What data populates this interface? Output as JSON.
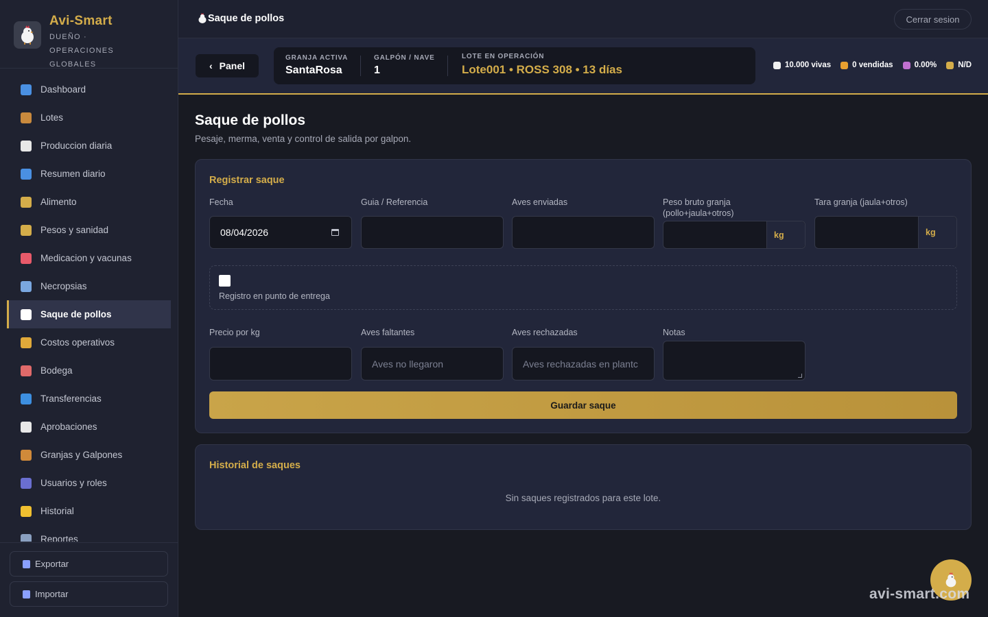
{
  "brand": {
    "name": "Avi-Smart",
    "subtitle": "DUEÑO · OPERACIONES GLOBALES"
  },
  "sidebar": {
    "items": [
      {
        "label": "Dashboard",
        "icon": "bar-chart-icon",
        "color": "#4a90e2"
      },
      {
        "label": "Lotes",
        "icon": "box-icon",
        "color": "#c98a3d"
      },
      {
        "label": "Produccion diaria",
        "icon": "clipboard-icon",
        "color": "#e8e8e8"
      },
      {
        "label": "Resumen diario",
        "icon": "bar-chart-icon",
        "color": "#4a90e2"
      },
      {
        "label": "Alimento",
        "icon": "grain-icon",
        "color": "#d4ad4a"
      },
      {
        "label": "Pesos y sanidad",
        "icon": "scale-icon",
        "color": "#d4ad4a"
      },
      {
        "label": "Medicacion y vacunas",
        "icon": "pill-icon",
        "color": "#e85a6a"
      },
      {
        "label": "Necropsias",
        "icon": "microscope-icon",
        "color": "#7aa7e0"
      },
      {
        "label": "Saque de pollos",
        "icon": "chicken-icon",
        "color": "#ffffff",
        "active": true
      },
      {
        "label": "Costos operativos",
        "icon": "money-bag-icon",
        "color": "#e0a93a"
      },
      {
        "label": "Bodega",
        "icon": "store-icon",
        "color": "#e06a6a"
      },
      {
        "label": "Transferencias",
        "icon": "transfer-icon",
        "color": "#3d8fe0"
      },
      {
        "label": "Aprobaciones",
        "icon": "clipboard-icon",
        "color": "#e8e8e8"
      },
      {
        "label": "Granjas y Galpones",
        "icon": "house-icon",
        "color": "#d08a3a"
      },
      {
        "label": "Usuarios y roles",
        "icon": "users-icon",
        "color": "#6a6fd0"
      },
      {
        "label": "Historial",
        "icon": "folder-icon",
        "color": "#f0c030"
      },
      {
        "label": "Reportes",
        "icon": "chart-icon",
        "color": "#8aa0c0"
      }
    ],
    "footer": [
      {
        "label": "Exportar",
        "icon": "export-icon"
      },
      {
        "label": "Importar",
        "icon": "import-icon"
      }
    ]
  },
  "topbar": {
    "title": "Saque de pollos",
    "logout_label": "Cerrar sesion"
  },
  "context": {
    "back_label": "Panel",
    "farm_label": "GRANJA ACTIVA",
    "farm_value": "SantaRosa",
    "shed_label": "GALPÓN / NAVE",
    "shed_value": "1",
    "lot_label": "LOTE EN OPERACIÓN",
    "lot_value": "Lote001 • ROSS 308 • 13 días",
    "stats": [
      {
        "text": "10.000 vivas",
        "icon": "chicken-icon",
        "color": "#f0f0f0"
      },
      {
        "text": "0 vendidas",
        "icon": "truck-icon",
        "color": "#e8a030"
      },
      {
        "text": "0.00%",
        "icon": "feather-icon",
        "color": "#c070d0"
      },
      {
        "text": "N/D",
        "icon": "scale-icon",
        "color": "#d4ad4a"
      }
    ]
  },
  "page": {
    "title": "Saque de pollos",
    "subtitle": "Pesaje, merma, venta y control de salida por galpon."
  },
  "form": {
    "title": "Registrar saque",
    "fecha_label": "Fecha",
    "fecha_value": "08/04/2026",
    "guia_label": "Guia / Referencia",
    "guia_value": "",
    "aves_enviadas_label": "Aves enviadas",
    "aves_enviadas_value": "",
    "peso_bruto_label": "Peso bruto granja (pollo+jaula+otros)",
    "peso_bruto_unit": "kg",
    "tara_label": "Tara granja (jaula+otros)",
    "tara_unit": "kg",
    "entrega_checkbox_label": "Registro en punto de entrega",
    "entrega_checked": false,
    "precio_label": "Precio por kg",
    "precio_value": "",
    "faltantes_label": "Aves faltantes",
    "faltantes_placeholder": "Aves no llegaron",
    "rechazadas_label": "Aves rechazadas",
    "rechazadas_placeholder": "Aves rechazadas en plantc",
    "notas_label": "Notas",
    "notas_value": "",
    "save_label": "Guardar saque"
  },
  "history": {
    "title": "Historial de saques",
    "empty_message": "Sin saques registrados para este lote."
  },
  "watermark": "avi-smart.com",
  "colors": {
    "accent": "#d4ad4a",
    "background": "#181a22",
    "sidebar": "#1f2230",
    "card": "#22263a",
    "input": "#151720"
  }
}
